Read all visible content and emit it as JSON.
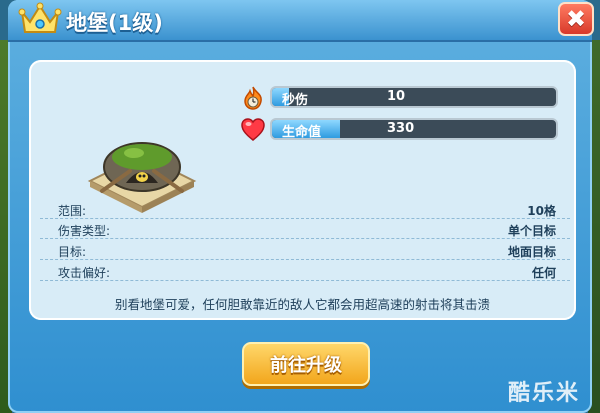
{
  "header": {
    "title": "地堡(1级)"
  },
  "stats": [
    {
      "label": "秒伤",
      "value": "10",
      "fill": 0.06,
      "icon": "flame-icon"
    },
    {
      "label": "生命值",
      "value": "330",
      "fill": 0.24,
      "icon": "heart-icon"
    }
  ],
  "info": [
    {
      "key": "范围:",
      "value": "10格"
    },
    {
      "key": "伤害类型:",
      "value": "单个目标"
    },
    {
      "key": "目标:",
      "value": "地面目标"
    },
    {
      "key": "攻击偏好:",
      "value": "任何"
    }
  ],
  "description": "别看地堡可爱，任何胆敢靠近的敌人它都会用超高速的射击将其击溃",
  "buttons": {
    "upgrade_label": "前往升级",
    "close_label": "✖"
  },
  "watermark": "酷乐米",
  "colors": {
    "bar_fill": "#2f9be0",
    "button": "#f2a61c",
    "close": "#d8392a",
    "header": "#3b92cf"
  }
}
